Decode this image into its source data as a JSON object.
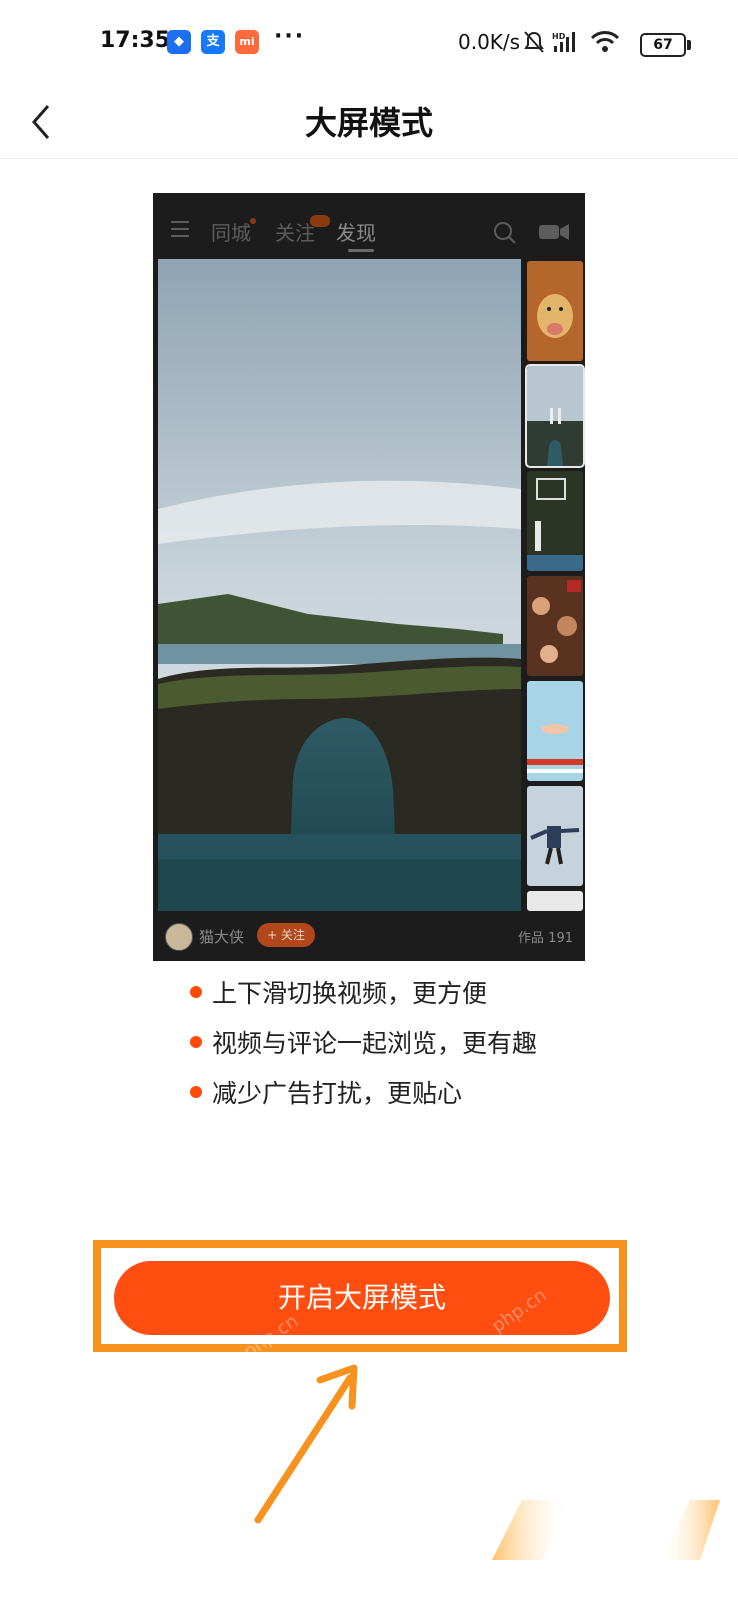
{
  "status_bar": {
    "time": "17:35",
    "speed": "0.0K/s",
    "battery": "67",
    "app_icons": [
      "alipay-blue-icon",
      "alipay-icon",
      "mi-icon"
    ],
    "overflow": "···"
  },
  "header": {
    "title": "大屏模式"
  },
  "preview": {
    "tabs": [
      "同城",
      "关注",
      "发现"
    ],
    "active_tab": "发现",
    "author": "猫大侠",
    "follow_label": "+ 关注",
    "works_label": "作品 191"
  },
  "features": [
    "上下滑切换视频，更方便",
    "视频与评论一起浏览，更有趣",
    "减少广告打扰，更贴心"
  ],
  "cta": {
    "label": "开启大屏模式"
  },
  "colors": {
    "accent": "#ff4e0f",
    "annotation": "#f7921e",
    "preview_bg": "#1c1c1c"
  }
}
